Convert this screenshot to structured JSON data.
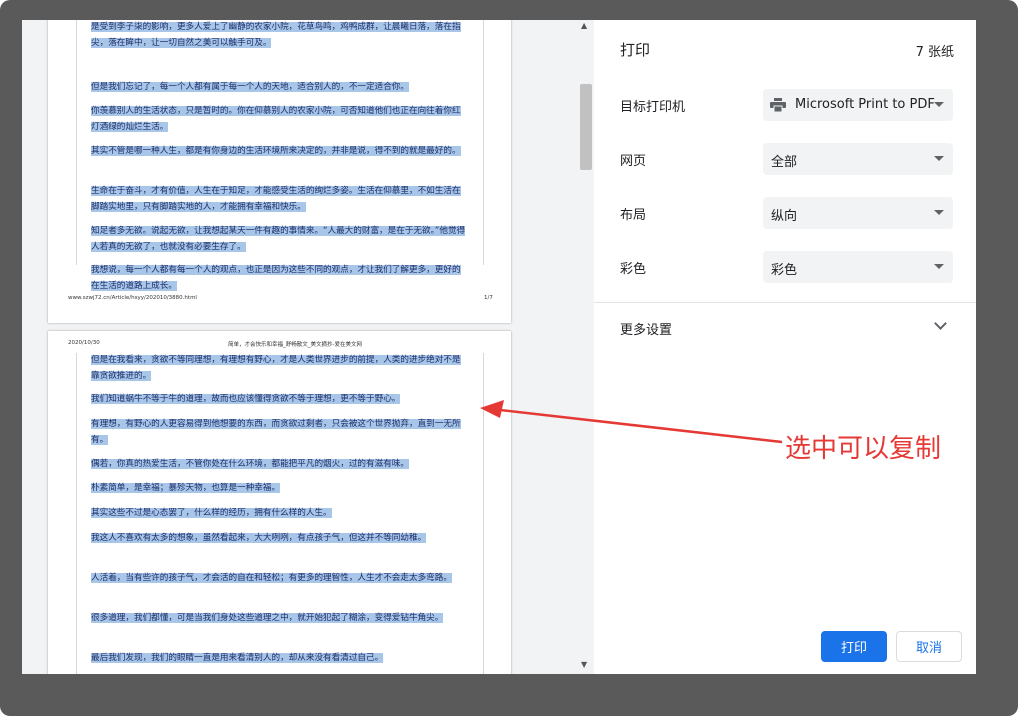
{
  "preview": {
    "page1": {
      "paragraphs": [
        "是受到李子柒的影响，更多人爱上了幽静的农家小院，花草鸟鸣，鸡鸭成群，让晨曦日落，落在指尖，落在眸中，让一切自然之美可以触手可及。",
        "但是我们忘记了，每一个人都有属于每一个人的天地，适合别人的，不一定适合你。",
        "你羡慕别人的生活状态，只是暂时的。你在仰慕别人的农家小院，可否知道他们也正在向往着你红灯酒绿的灿烂生活。",
        "其实不管是哪一种人生，都是有你身边的生活环境所来决定的，并非是说，得不到的就是最好的。",
        "生命在于奋斗，才有价值，人生在于知足，才能感受生活的绚烂多姿。生活在仰慕里，不如生活在脚踏实地里，只有脚踏实地的人，才能拥有幸福和快乐。",
        "知足者多无欲。说起无欲，让我想起某天一件有趣的事情来。“人最大的财富，是在于无欲。”他觉得人若真的无欲了，也就没有必要生存了。",
        "我想说，每一个人都有每一个人的观点，也正是因为这些不同的观点，才让我们了解更多，更好的在生活的道路上成长。"
      ],
      "footer_url": "www.szwj72.cn/Article/hsyy/202010/3880.html",
      "footer_page": "1/7"
    },
    "page2": {
      "header_date": "2020/10/30",
      "header_title": "简单，才会快乐和幸福_舒畅散文_美文摘抄-爱在美文网",
      "paragraphs": [
        "但是在我看来，贪欲不等同理想，有理想有野心，才是人类世界进步的前提，人类的进步绝对不是靠贪欲推进的。",
        "我们知道蜗牛不等于牛的道理，故而也应该懂得贪欲不等于理想，更不等于野心。",
        "有理想，有野心的人更容易得到他想要的东西，而贪欲过剩者，只会被这个世界抛弃，直到一无所有。",
        "偶若，你真的热爱生活，不管你处在什么环境，都能把平凡的烟火，过的有滋有味。",
        "朴素简单，是幸福；暴殄天物，也算是一种幸福。",
        "其实这些不过是心态罢了，什么样的经历，拥有什么样的人生。",
        "我这人不喜欢有太多的想象，虽然看起来，大大咧咧，有点孩子气，但这并不等同幼稚。",
        "人活着，当有些许的孩子气，才会活的自在和轻松；有更多的理智性，人生才不会走太多弯路。",
        "很多道理，我们都懂，可是当我们身处这些道理之中，就开始犯起了糊涂，变得爱钻牛角尖。",
        "最后我们发现，我们的眼睛一直是用来看清别人的，却从来没有看清过自己。"
      ]
    }
  },
  "settings": {
    "title": "打印",
    "sheet_count": "7 张纸",
    "rows": [
      {
        "label": "目标打印机",
        "value": "Microsoft Print to PDF",
        "icon": "printer-icon"
      },
      {
        "label": "网页",
        "value": "全部"
      },
      {
        "label": "布局",
        "value": "纵向"
      },
      {
        "label": "彩色",
        "value": "彩色"
      }
    ],
    "more_settings": "更多设置",
    "print_button": "打印",
    "cancel_button": "取消"
  },
  "annotation": {
    "text": "选中可以复制",
    "color": "#e53935"
  },
  "colors": {
    "accent": "#1a73e8",
    "highlight": "#a8c6e8",
    "text_blue": "#1f2e6b"
  }
}
